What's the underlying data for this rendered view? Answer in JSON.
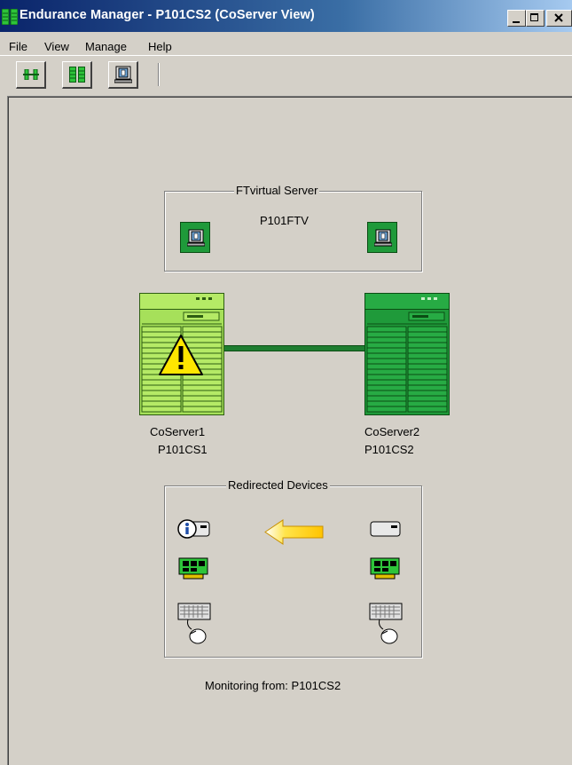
{
  "window": {
    "title": "Endurance Manager - P101CS2 (CoServer View)",
    "controls": {
      "minimize": "_",
      "maximize": "□",
      "close": "×"
    }
  },
  "menu": {
    "items": [
      "File",
      "View",
      "Manage",
      "Help"
    ]
  },
  "toolbar": {
    "buttons": [
      {
        "icon": "link-icon"
      },
      {
        "icon": "servers-icon"
      },
      {
        "icon": "virtual-server-icon"
      }
    ]
  },
  "ftvirtual": {
    "title": "FTvirtual Server",
    "name": "P101FTV"
  },
  "coservers": [
    {
      "label": "CoServer1",
      "name": "P101CS1",
      "status": "warning"
    },
    {
      "label": "CoServer2",
      "name": "P101CS2",
      "status": "ok"
    }
  ],
  "redirected": {
    "title": "Redirected Devices",
    "direction": "right-to-left"
  },
  "monitoring": {
    "text": "Monitoring from: P101CS2"
  },
  "colors": {
    "title_bar_start": "#0a246a",
    "green_light": "#a6e05a",
    "green_dark": "#1f9a3a",
    "link_green": "#1e7d30",
    "arrow_yellow": "#ffd400"
  }
}
